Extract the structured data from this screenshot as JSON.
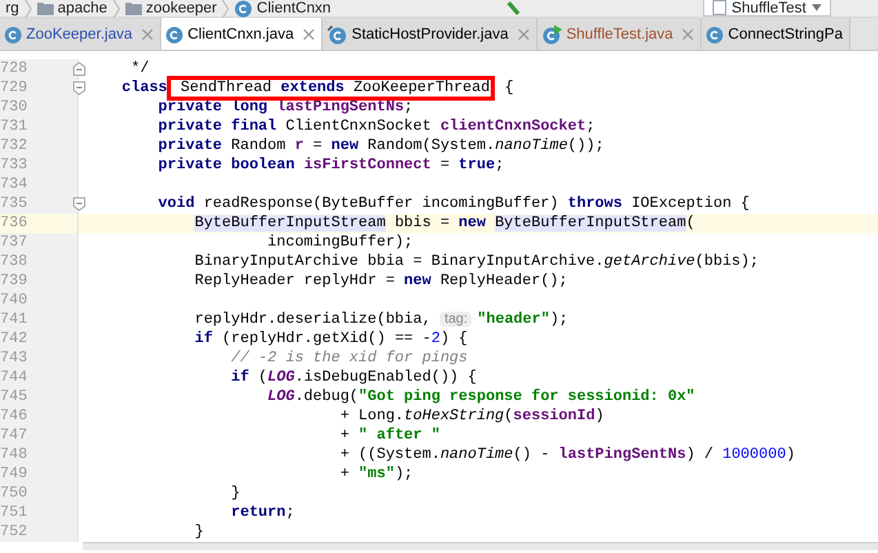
{
  "breadcrumbs": [
    {
      "label": "rg",
      "kind": "folder-cut"
    },
    {
      "label": "apache",
      "kind": "folder"
    },
    {
      "label": "zookeeper",
      "kind": "folder"
    },
    {
      "label": "ClientCnxn",
      "kind": "class"
    }
  ],
  "run_config": {
    "label": "ShuffleTest"
  },
  "tabs": [
    {
      "label": "ZooKeeper.java",
      "kind": "class",
      "color": "#2b4fb0",
      "selected": false,
      "closable": true
    },
    {
      "label": "ClientCnxn.java",
      "kind": "class",
      "color": "#000000",
      "selected": true,
      "closable": true
    },
    {
      "label": "StaticHostProvider.java",
      "kind": "abstract",
      "color": "#000000",
      "selected": false,
      "closable": true
    },
    {
      "label": "ShuffleTest.java",
      "kind": "test",
      "color": "#a0522d",
      "selected": false,
      "closable": true
    },
    {
      "label": "ConnectStringPa",
      "kind": "class",
      "color": "#000000",
      "selected": false,
      "closable": false
    }
  ],
  "code_lines": [
    {
      "number": "728",
      "kind": "fold-end",
      "current": false,
      "tokens": [
        {
          "text": "     */",
          "kind": "plain"
        }
      ]
    },
    {
      "number": "729",
      "kind": "fold-start",
      "current": false,
      "tokens": [
        {
          "text": "    class",
          "kind": "keyword"
        },
        {
          "text": " SendThread ",
          "kind": "plain",
          "boxed": true
        },
        {
          "text": "extends",
          "kind": "keyword",
          "boxed": true
        },
        {
          "text": " ZooKeeperThread",
          "kind": "plain",
          "boxed": true
        },
        {
          "text": " {",
          "kind": "plain"
        }
      ]
    },
    {
      "number": "730",
      "kind": "plain",
      "current": false,
      "tokens": [
        {
          "text": "        private long ",
          "kind": "keyword"
        },
        {
          "text": "lastPingSentNs",
          "kind": "field"
        },
        {
          "text": ";",
          "kind": "plain"
        }
      ]
    },
    {
      "number": "731",
      "kind": "plain",
      "current": false,
      "tokens": [
        {
          "text": "        private final",
          "kind": "keyword"
        },
        {
          "text": " ClientCnxnSocket ",
          "kind": "plain"
        },
        {
          "text": "clientCnxnSocket",
          "kind": "field"
        },
        {
          "text": ";",
          "kind": "plain"
        }
      ]
    },
    {
      "number": "732",
      "kind": "plain",
      "current": false,
      "tokens": [
        {
          "text": "        private",
          "kind": "keyword"
        },
        {
          "text": " Random ",
          "kind": "plain"
        },
        {
          "text": "r",
          "kind": "field"
        },
        {
          "text": " = ",
          "kind": "plain"
        },
        {
          "text": "new",
          "kind": "keyword"
        },
        {
          "text": " Random(System.",
          "kind": "plain"
        },
        {
          "text": "nanoTime",
          "kind": "italic"
        },
        {
          "text": "());",
          "kind": "plain"
        }
      ]
    },
    {
      "number": "733",
      "kind": "plain",
      "current": false,
      "tokens": [
        {
          "text": "        private boolean ",
          "kind": "keyword"
        },
        {
          "text": "isFirstConnect",
          "kind": "field"
        },
        {
          "text": " = ",
          "kind": "plain"
        },
        {
          "text": "true",
          "kind": "keyword"
        },
        {
          "text": ";",
          "kind": "plain"
        }
      ]
    },
    {
      "number": "734",
      "kind": "plain",
      "current": false
    },
    {
      "number": "735",
      "kind": "fold-start",
      "current": false,
      "tokens": [
        {
          "text": "        void",
          "kind": "keyword"
        },
        {
          "text": " readResponse(ByteBuffer incomingBuffer) ",
          "kind": "plain"
        },
        {
          "text": "throws",
          "kind": "keyword"
        },
        {
          "text": " IOException {",
          "kind": "plain"
        }
      ]
    },
    {
      "number": "736",
      "kind": "plain",
      "current": true,
      "tokens": [
        {
          "text": "            ByteBufferInputStream",
          "kind": "usage"
        },
        {
          "text": " bbis = ",
          "kind": "plain"
        },
        {
          "text": "new ",
          "kind": "keyword"
        },
        {
          "text": "ByteBufferInputStream",
          "kind": "usage"
        },
        {
          "text": "(",
          "kind": "plain"
        }
      ]
    },
    {
      "number": "737",
      "kind": "plain",
      "current": false,
      "tokens": [
        {
          "text": "                    incomingBuffer);",
          "kind": "plain"
        }
      ]
    },
    {
      "number": "738",
      "kind": "plain",
      "current": false,
      "tokens": [
        {
          "text": "            BinaryInputArchive bbia = BinaryInputArchive.",
          "kind": "plain"
        },
        {
          "text": "getArchive",
          "kind": "italic"
        },
        {
          "text": "(bbis);",
          "kind": "plain"
        }
      ]
    },
    {
      "number": "739",
      "kind": "plain",
      "current": false,
      "tokens": [
        {
          "text": "            ReplyHeader replyHdr = ",
          "kind": "plain"
        },
        {
          "text": "new",
          "kind": "keyword"
        },
        {
          "text": " ReplyHeader();",
          "kind": "plain"
        }
      ]
    },
    {
      "number": "740",
      "kind": "plain",
      "current": false
    },
    {
      "number": "741",
      "kind": "plain",
      "current": false,
      "tokens": [
        {
          "text": "            replyHdr.deserialize(bbia, ",
          "kind": "plain"
        },
        {
          "text": "tag:",
          "kind": "hint"
        },
        {
          "text": "\"header\"",
          "kind": "string"
        },
        {
          "text": ");",
          "kind": "plain"
        }
      ]
    },
    {
      "number": "742",
      "kind": "plain",
      "current": false,
      "tokens": [
        {
          "text": "            if",
          "kind": "keyword"
        },
        {
          "text": " (replyHdr.getXid() == -",
          "kind": "plain"
        },
        {
          "text": "2",
          "kind": "number"
        },
        {
          "text": ") {",
          "kind": "plain"
        }
      ]
    },
    {
      "number": "743",
      "kind": "plain",
      "current": false,
      "tokens": [
        {
          "text": "                // -2 is the xid for pings",
          "kind": "comment"
        }
      ]
    },
    {
      "number": "744",
      "kind": "plain",
      "current": false,
      "tokens": [
        {
          "text": "                if",
          "kind": "keyword"
        },
        {
          "text": " (",
          "kind": "plain"
        },
        {
          "text": "LOG",
          "kind": "static"
        },
        {
          "text": ".isDebugEnabled()) {",
          "kind": "plain"
        }
      ]
    },
    {
      "number": "745",
      "kind": "plain",
      "current": false,
      "tokens": [
        {
          "text": "                    LOG",
          "kind": "static"
        },
        {
          "text": ".debug(",
          "kind": "plain"
        },
        {
          "text": "\"Got ping response for sessionid: 0x\"",
          "kind": "string"
        }
      ]
    },
    {
      "number": "746",
      "kind": "plain",
      "current": false,
      "tokens": [
        {
          "text": "                            + Long.",
          "kind": "plain"
        },
        {
          "text": "toHexString",
          "kind": "italic"
        },
        {
          "text": "(",
          "kind": "plain"
        },
        {
          "text": "sessionId",
          "kind": "field"
        },
        {
          "text": ")",
          "kind": "plain"
        }
      ]
    },
    {
      "number": "747",
      "kind": "plain",
      "current": false,
      "tokens": [
        {
          "text": "                            + ",
          "kind": "plain"
        },
        {
          "text": "\" after \"",
          "kind": "string"
        }
      ]
    },
    {
      "number": "748",
      "kind": "plain",
      "current": false,
      "tokens": [
        {
          "text": "                            + ((System.",
          "kind": "plain"
        },
        {
          "text": "nanoTime",
          "kind": "italic"
        },
        {
          "text": "() - ",
          "kind": "plain"
        },
        {
          "text": "lastPingSentNs",
          "kind": "field"
        },
        {
          "text": ") / ",
          "kind": "plain"
        },
        {
          "text": "1000000",
          "kind": "number"
        },
        {
          "text": ")",
          "kind": "plain"
        }
      ]
    },
    {
      "number": "749",
      "kind": "plain",
      "current": false,
      "tokens": [
        {
          "text": "                            + ",
          "kind": "plain"
        },
        {
          "text": "\"ms\"",
          "kind": "string"
        },
        {
          "text": ");",
          "kind": "plain"
        }
      ]
    },
    {
      "number": "750",
      "kind": "plain",
      "current": false,
      "tokens": [
        {
          "text": "                }",
          "kind": "plain"
        }
      ]
    },
    {
      "number": "751",
      "kind": "plain",
      "current": false,
      "tokens": [
        {
          "text": "                return",
          "kind": "keyword"
        },
        {
          "text": ";",
          "kind": "plain"
        }
      ]
    },
    {
      "number": "752",
      "kind": "plain",
      "current": false,
      "tokens": [
        {
          "text": "            }",
          "kind": "plain"
        }
      ]
    }
  ]
}
